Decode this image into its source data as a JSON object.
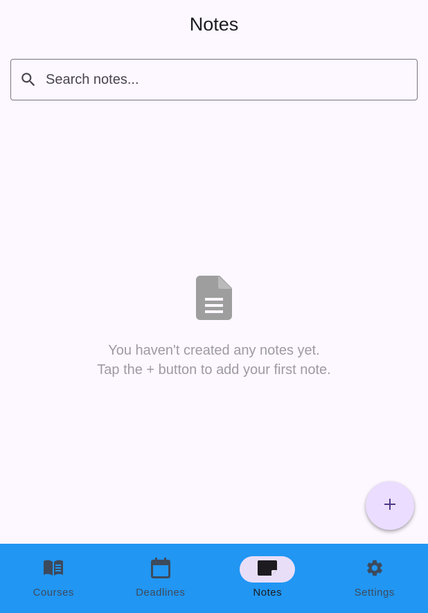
{
  "appbar": {
    "title": "Notes"
  },
  "search": {
    "placeholder": "Search notes...",
    "icon": "search-icon"
  },
  "empty_state": {
    "icon": "document-icon",
    "line1": "You haven't created any notes yet.",
    "line2": "Tap the + button to add your first note."
  },
  "fab": {
    "icon": "add-icon"
  },
  "nav": {
    "items": [
      {
        "label": "Courses",
        "icon": "book-icon",
        "active": false
      },
      {
        "label": "Deadlines",
        "icon": "calendar-icon",
        "active": false
      },
      {
        "label": "Notes",
        "icon": "note-icon",
        "active": true
      },
      {
        "label": "Settings",
        "icon": "gear-icon",
        "active": false
      }
    ]
  },
  "colors": {
    "background": "#fdf7ff",
    "navbar": "#2196f3",
    "active_pill": "#e8def8",
    "fab": "#ebddff",
    "fab_icon": "#4f378b",
    "empty_icon": "#9e9e9e"
  }
}
